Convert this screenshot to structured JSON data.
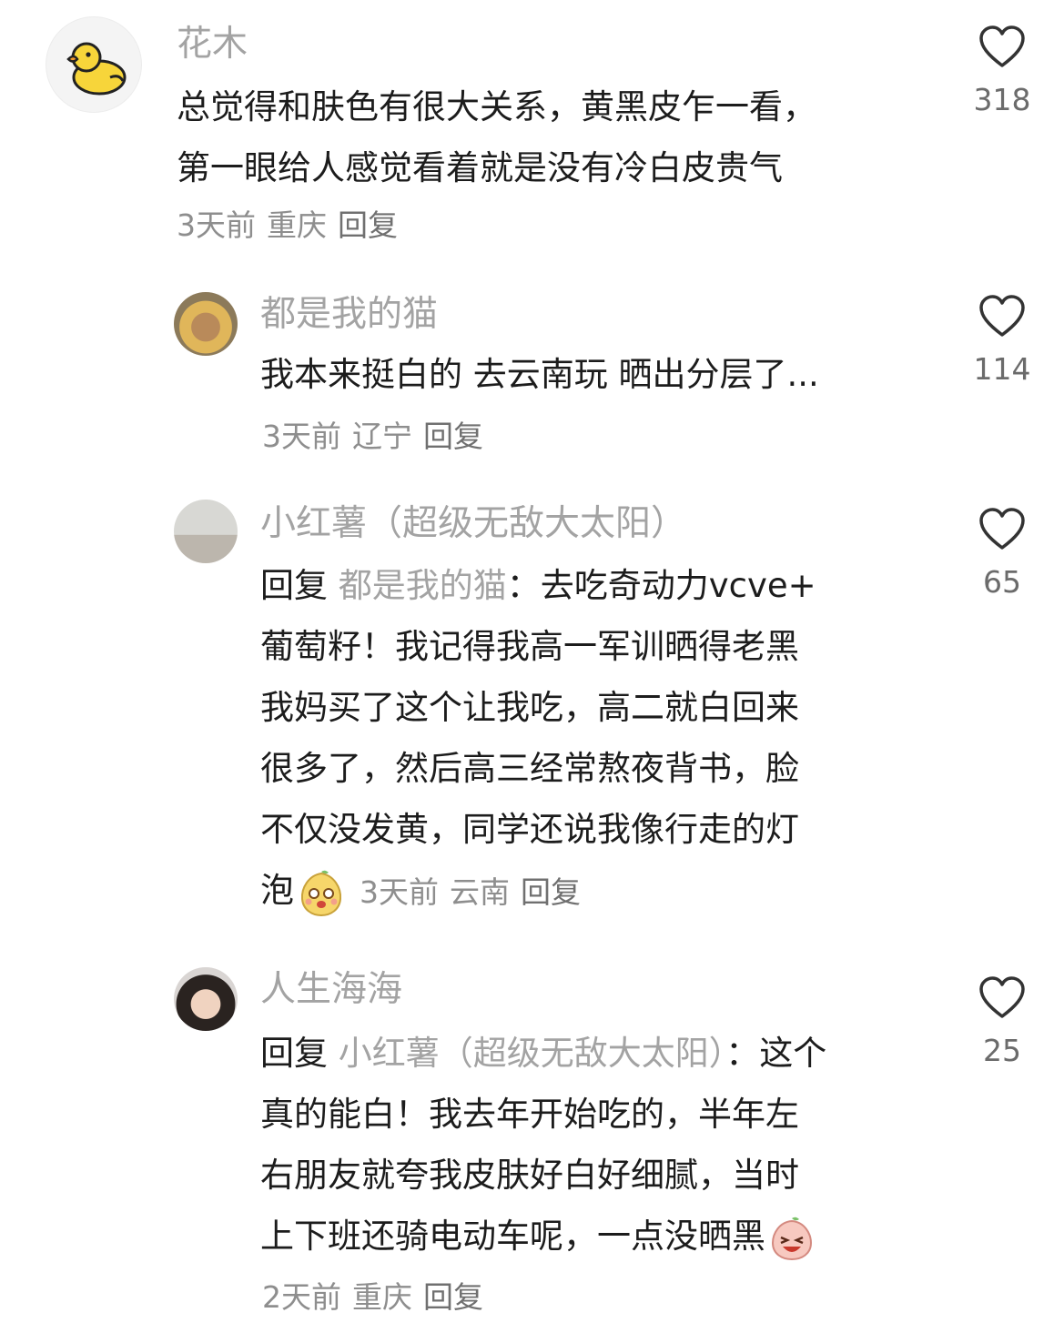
{
  "comments": [
    {
      "username": "花木",
      "text_lines": [
        "总觉得和肤色有很大关系，黄黑皮乍一看，",
        "第一眼给人感觉看着就是没有冷白皮贵气"
      ],
      "time": "3天前",
      "location": "重庆",
      "reply_label": "回复",
      "likes": "318",
      "avatar_icon": "yellow-duck-icon"
    },
    {
      "username": "都是我的猫",
      "text_lines": [
        "我本来挺白的 去云南玩 晒出分层了..."
      ],
      "time": "3天前",
      "location": "辽宁",
      "reply_label": "回复",
      "likes": "114"
    },
    {
      "username": "小红薯（超级无敌大太阳）",
      "reply_prefix": "回复 ",
      "reply_to": "都是我的猫",
      "reply_colon": "：",
      "first_line_rest": "去吃奇动力vcve+",
      "text_lines": [
        "葡萄籽！我记得我高一军训晒得老黑",
        "我妈买了这个让我吃，高二就白回来",
        "很多了，然后高三经常熬夜背书，脸",
        "不仅没发黄，同学还说我像行走的灯"
      ],
      "last_line": "泡",
      "emoji_icon": "happy-dumpling-emoji-icon",
      "time": "3天前",
      "location": "云南",
      "reply_label": "回复",
      "likes": "65"
    },
    {
      "username": "人生海海",
      "reply_prefix": "回复 ",
      "reply_to": "小红薯（超级无敌大太阳）",
      "reply_colon": "：",
      "first_line_rest": "这个",
      "text_lines": [
        "真的能白！我去年开始吃的，半年左",
        "右朋友就夸我皮肤好白好细腻，当时"
      ],
      "last_line": "上下班还骑电动车呢，一点没晒黑",
      "emoji_icon": "laughing-peach-emoji-icon",
      "time": "2天前",
      "location": "重庆",
      "reply_label": "回复",
      "likes": "25"
    }
  ]
}
